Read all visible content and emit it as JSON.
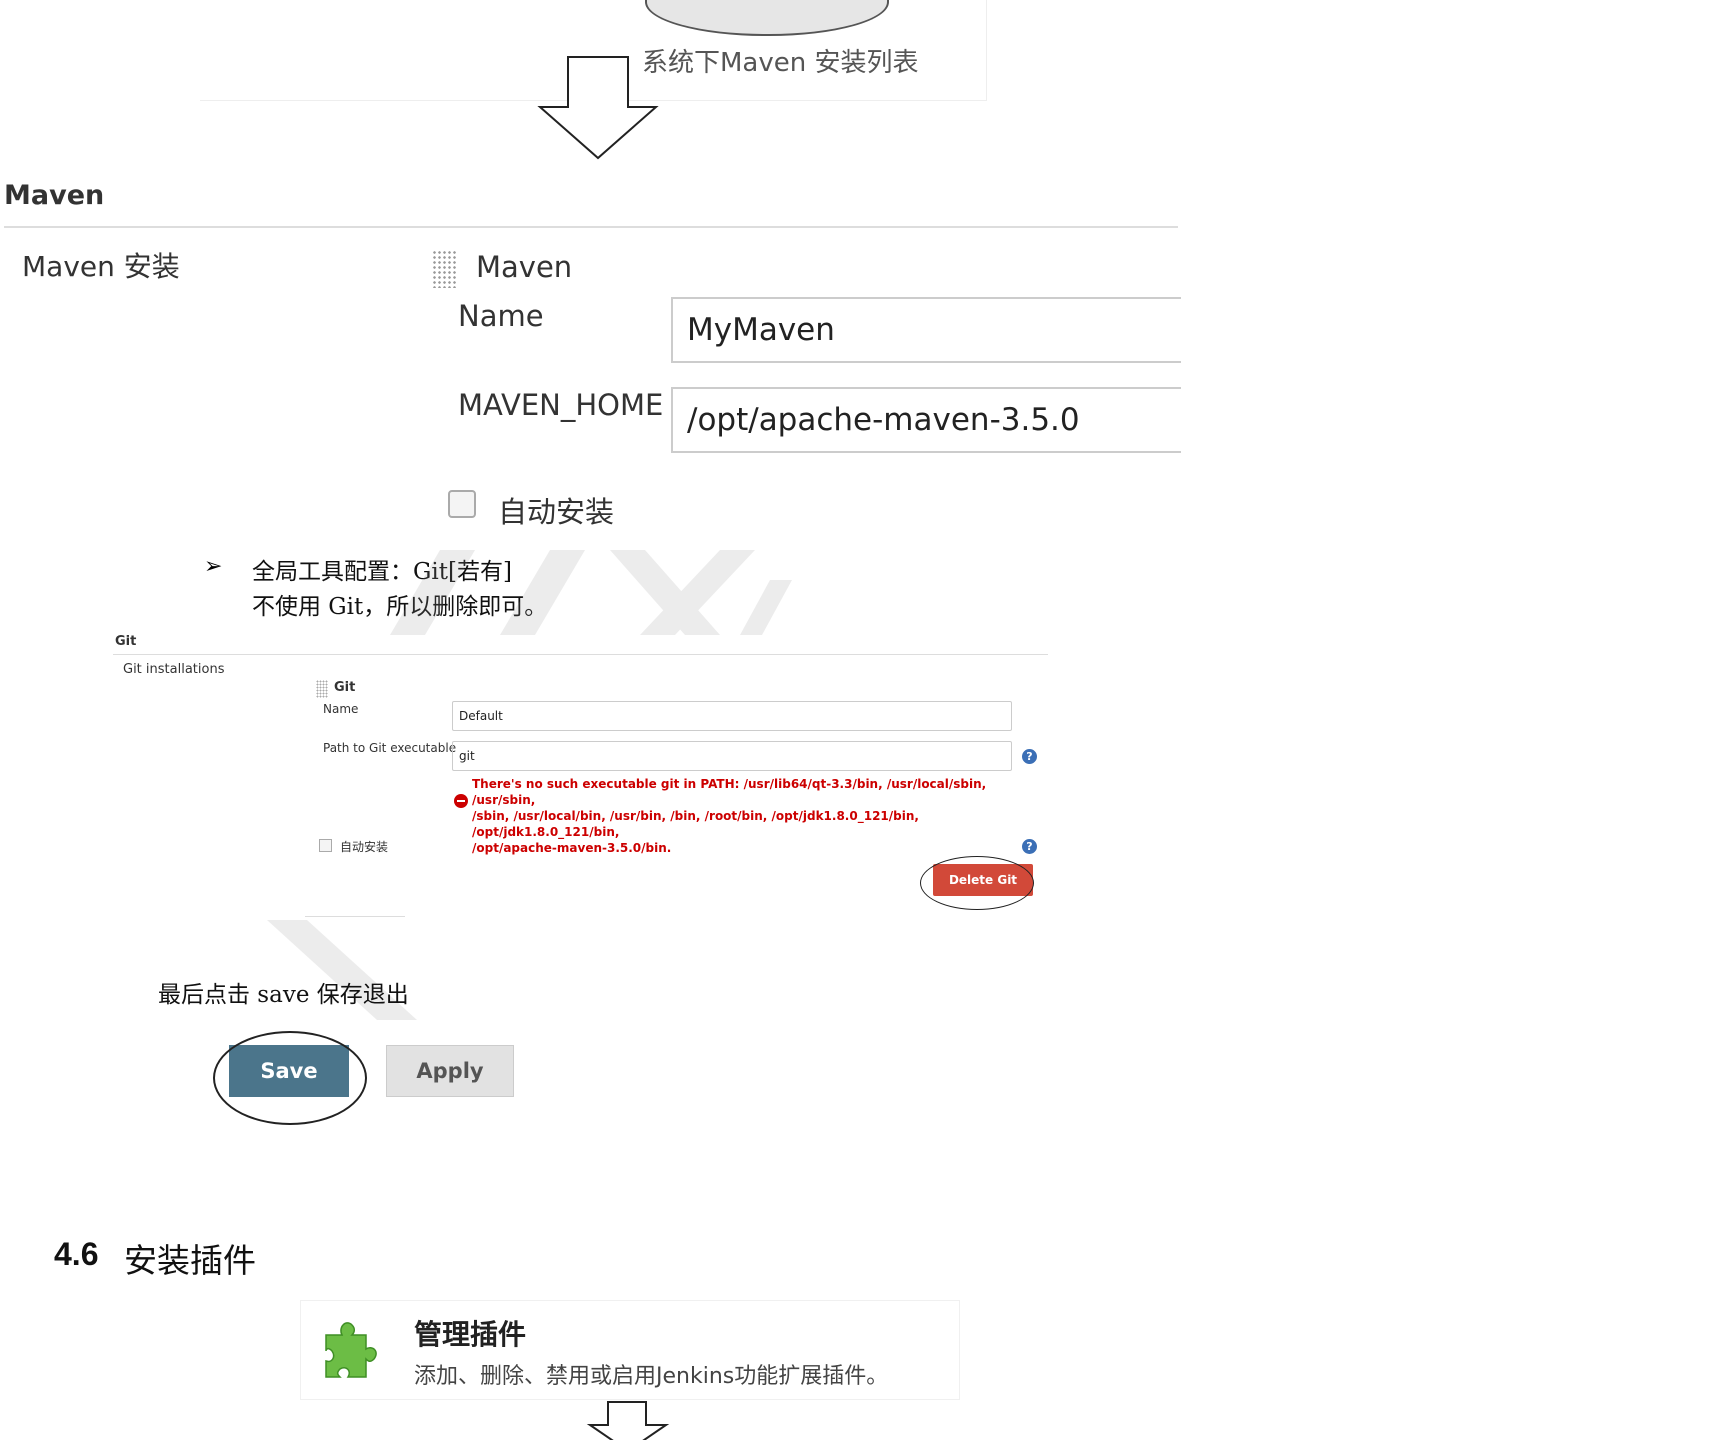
{
  "top_figure": {
    "caption": "系统下Maven 安装列表"
  },
  "maven": {
    "section_title": "Maven",
    "installations_label": "Maven 安装",
    "entry_name": "Maven",
    "name_label": "Name",
    "name_value": "MyMaven",
    "home_label": "MAVEN_HOME",
    "home_value": "/opt/apache-maven-3.5.0",
    "auto_install_label": "自动安装"
  },
  "bullet": {
    "arrow": "➢",
    "text": "全局工具配置：Git[若有]",
    "sub_text": "不使用 Git，所以删除即可。"
  },
  "git": {
    "section_title": "Git",
    "installations_label": "Git installations",
    "entry_name": "Git",
    "name_label": "Name",
    "name_value": "Default",
    "path_label": "Path to Git executable",
    "path_value": "git",
    "error_line1": "There's no such executable git in PATH: /usr/lib64/qt-3.3/bin, /usr/local/sbin, /usr/sbin,",
    "error_line2": "/sbin, /usr/local/bin, /usr/bin, /bin, /root/bin, /opt/jdk1.8.0_121/bin, /opt/jdk1.8.0_121/bin,",
    "error_line3": "/opt/apache-maven-3.5.0/bin.",
    "auto_install_label": "自动安装",
    "delete_button": "Delete Git",
    "help_glyph": "?"
  },
  "final": {
    "text": "最后点击 save 保存退出",
    "save_button": "Save",
    "apply_button": "Apply"
  },
  "section": {
    "number": "4.6",
    "title": "安装插件"
  },
  "plugin_card": {
    "title": "管理插件",
    "description": "添加、删除、禁用或启用Jenkins功能扩展插件。",
    "icon": "puzzle-icon"
  },
  "colors": {
    "error": "#cc0000",
    "delete_button": "#d24939",
    "save_button": "#4b758b",
    "help_icon": "#3b6fb6",
    "puzzle_green": "#6cbd45"
  }
}
